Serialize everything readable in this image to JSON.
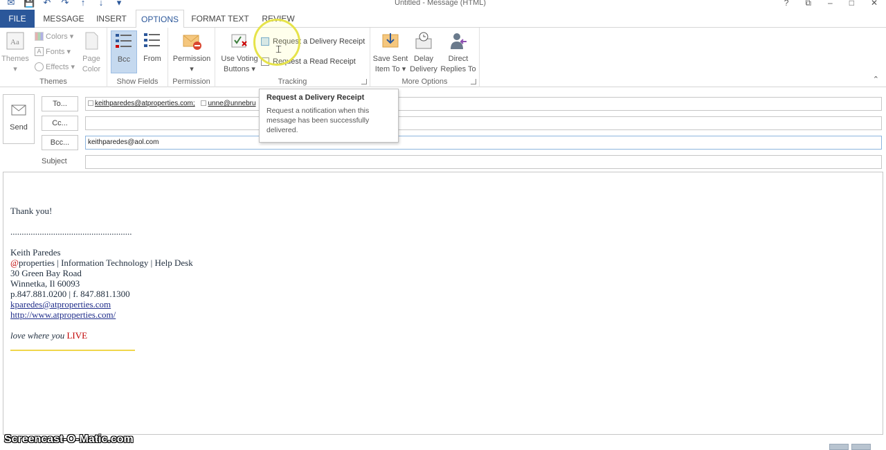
{
  "window": {
    "title": "Untitled - Message (HTML)",
    "controls": [
      "?",
      "⧉",
      "–",
      "□",
      "✕"
    ]
  },
  "tabs": [
    {
      "label": "FILE"
    },
    {
      "label": "MESSAGE"
    },
    {
      "label": "INSERT"
    },
    {
      "label": "OPTIONS"
    },
    {
      "label": "FORMAT TEXT"
    },
    {
      "label": "REVIEW"
    }
  ],
  "ribbon": {
    "themes": {
      "themes_label": "Themes",
      "colors_label": "Colors",
      "fonts_label": "Fonts",
      "effects_label": "Effects",
      "page_color_label": "Page Color",
      "group_label": "Themes"
    },
    "show_fields": {
      "bcc_label": "Bcc",
      "from_label": "From",
      "group_label": "Show Fields"
    },
    "permission": {
      "permission_label": "Permission",
      "group_label": "Permission"
    },
    "tracking": {
      "voting_label": "Use Voting Buttons",
      "delivery_receipt_label": "Request a Delivery Receipt",
      "read_receipt_label": "Request a Read Receipt",
      "group_label": "Tracking"
    },
    "more_options": {
      "save_sent_label": "Save Sent Item To",
      "delay_label": "Delay Delivery",
      "direct_label": "Direct Replies To",
      "group_label": "More Options"
    }
  },
  "compose": {
    "send_label": "Send",
    "to_button": "To...",
    "cc_button": "Cc...",
    "bcc_button": "Bcc...",
    "subject_label": "Subject",
    "to_recipients": [
      "keithparedes@atproperties.com;",
      "unne@unnebru"
    ],
    "cc_value": "",
    "bcc_value": "keithparedes@aol.com",
    "subject_value": ""
  },
  "tooltip": {
    "title": "Request a Delivery Receipt",
    "body": "Request a notification when this message has been successfully delivered."
  },
  "body": {
    "greeting": "Thank you!",
    "separator": "......................................................",
    "name": "Keith Paredes",
    "company_at": "@",
    "company_rest": "properties | Information Technology | Help Desk",
    "address1": "30 Green Bay Road",
    "address2": "Winnetka, Il 60093",
    "phone": "p.847.881.0200 | f. 847.881.1300",
    "email": "kparedes@atproperties.com",
    "website": "http://www.atproperties.com/",
    "motto_prefix": "love where you ",
    "motto_live": "LIVE"
  },
  "watermark": "Screencast-O-Matic.com",
  "colors": {
    "accent": "#2b579a",
    "signature_red": "#c00000",
    "highlight_yellow": "#e6e34a"
  }
}
